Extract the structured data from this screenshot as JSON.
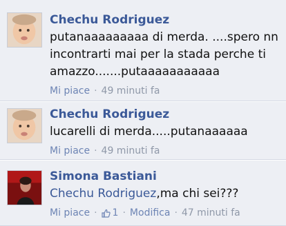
{
  "comments": [
    {
      "author": "Chechu Rodriguez",
      "text": "putanaaaaaaaaa di merda. ....spero nn incontrarti mai per la stada perche ti amazzo.......putaaaaaaaaaaa",
      "like_label": "Mi piace",
      "time": "49 minuti fa"
    },
    {
      "author": "Chechu Rodriguez",
      "text": "lucarelli di merda.....putanaaaaaa",
      "like_label": "Mi piace",
      "time": "49 minuti fa"
    },
    {
      "author": "Simona Bastiani",
      "mention": "Chechu Rodriguez",
      "text": ",ma chi sei???",
      "like_label": "Mi piace",
      "like_count": "1",
      "edit_label": "Modifica",
      "time": "47 minuti fa"
    }
  ],
  "colors": {
    "comment_bg": "#edeff4",
    "link": "#3b5998",
    "meta": "#8f98a8"
  }
}
